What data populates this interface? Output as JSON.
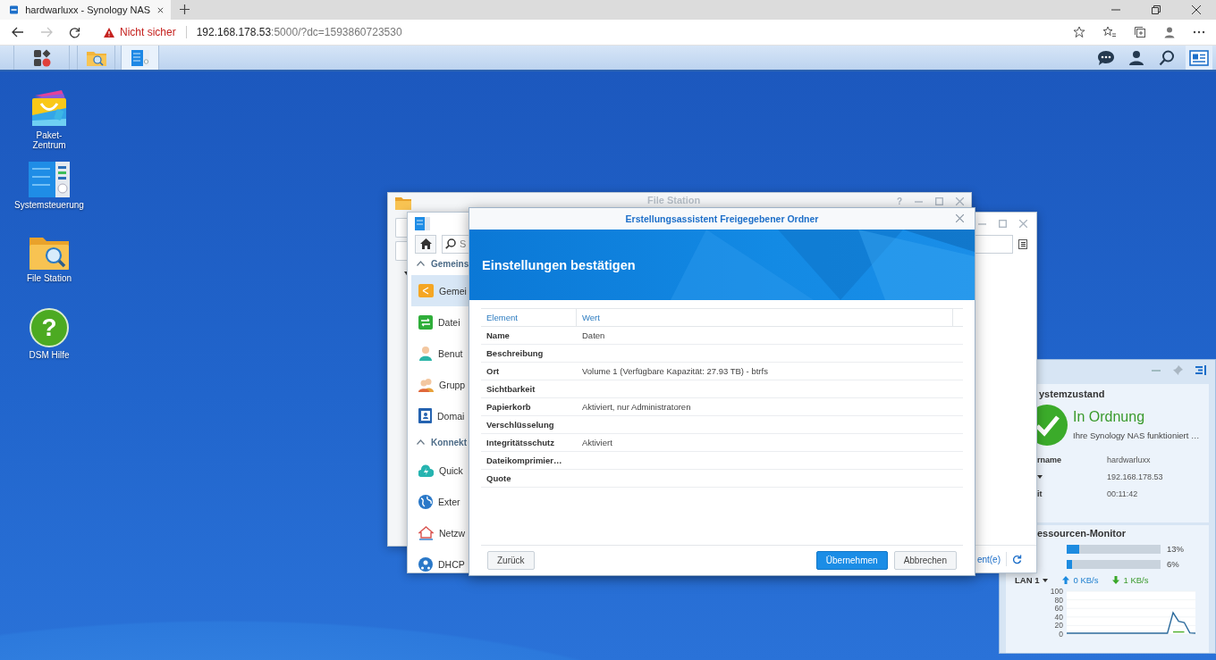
{
  "browser": {
    "tab_title": "hardwarluxx - Synology NAS",
    "security": "Nicht sicher",
    "url_host": "192.168.178.53",
    "url_rest": ":5000/?dc=1593860723530"
  },
  "taskbar": {
    "apps": [
      {
        "kind": "menu",
        "selected": false
      },
      {
        "kind": "file-station",
        "selected": false
      },
      {
        "kind": "control-panel",
        "selected": true
      }
    ],
    "tray": [
      {
        "kind": "chat",
        "selected": false
      },
      {
        "kind": "user",
        "selected": false
      },
      {
        "kind": "search",
        "selected": false
      },
      {
        "kind": "widgets",
        "selected": true
      }
    ]
  },
  "desktop_icons": [
    {
      "kind": "package",
      "label": "Paket-Zentrum"
    },
    {
      "kind": "control-panel",
      "label": "Systemsteuerung"
    },
    {
      "kind": "file-station",
      "label": "File Station"
    },
    {
      "kind": "help",
      "label": "DSM Hilfe",
      "glyph": "?"
    }
  ],
  "file_station": {
    "title": "File Station",
    "help": "?"
  },
  "control_panel": {
    "search_placeholder": "S",
    "footer_text": "ent(e)",
    "sections": [
      {
        "title": "Gemeins",
        "expanded": true,
        "items": [
          {
            "kind": "share",
            "label": "Gemei",
            "selected": true
          },
          {
            "kind": "file-services",
            "label": "Datei",
            "selected": false
          },
          {
            "kind": "user",
            "label": "Benut",
            "selected": false
          },
          {
            "kind": "group",
            "label": "Grupp",
            "selected": false
          },
          {
            "kind": "domain",
            "label": "Domai",
            "selected": false
          }
        ]
      },
      {
        "title": "Konnekt",
        "expanded": true,
        "items": [
          {
            "kind": "quickconnect",
            "label": "Quick",
            "selected": false
          },
          {
            "kind": "external",
            "label": "Exter",
            "selected": false
          },
          {
            "kind": "network",
            "label": "Netzw",
            "selected": false
          },
          {
            "kind": "dhcp",
            "label": "DHCP",
            "selected": false
          }
        ]
      }
    ]
  },
  "dialog": {
    "title": "Erstellungsassistent Freigegebener Ordner",
    "heading": "Einstellungen bestätigen",
    "columns": [
      "Element",
      "Wert"
    ],
    "rows": [
      {
        "element": "Name",
        "value": "Daten"
      },
      {
        "element": "Beschreibung"
      },
      {
        "element": "Ort",
        "value": "Volume 1 (Verfügbare Kapazität: 27.93 TB) - btrfs"
      },
      {
        "element": "Sichtbarkeit"
      },
      {
        "element": "Papierkorb",
        "value": "Aktiviert, nur Administratoren"
      },
      {
        "element": "Verschlüsselung"
      },
      {
        "element": "Integritätsschutz",
        "value": "Aktiviert"
      },
      {
        "element": "Dateikomprimier…"
      },
      {
        "element": "Quote"
      }
    ],
    "buttons": [
      {
        "label": "Zurück",
        "kind": "secondary"
      },
      {
        "label": "Übernehmen",
        "kind": "primary"
      },
      {
        "label": "Abbrechen",
        "kind": "secondary"
      }
    ]
  },
  "widgets": {
    "system": {
      "title": "ystemzustand",
      "status": "In Ordnung",
      "message": "Ihre Synology NAS funktioniert …",
      "rows": [
        {
          "label": "rname",
          "dropdown": false,
          "value": "hardwarluxx"
        },
        {
          "dropdown": true,
          "value": "192.168.178.53"
        },
        {
          "label": "it",
          "dropdown": false,
          "value": "00:11:42"
        }
      ]
    },
    "monitor": {
      "title": "essourcen-Monitor",
      "meters": [
        {
          "level": 0.13,
          "reading": "13%"
        },
        {
          "level": 0.06,
          "reading": "6%"
        }
      ],
      "interface": "LAN 1",
      "upload": "0 KB/s",
      "download": "1 KB/s",
      "chart_data": {
        "type": "line",
        "grid": true,
        "ylim": [
          0,
          100
        ],
        "yticks": [
          0,
          20,
          40,
          60,
          80,
          100
        ],
        "series": [
          {
            "color": "#2b6a9c",
            "values": [
              2,
              2,
              2,
              2,
              2,
              2,
              2,
              2,
              2,
              2,
              2,
              2,
              2,
              2,
              2,
              2,
              2,
              2,
              2,
              50,
              30,
              27,
              3,
              2
            ]
          },
          {
            "color": "#4caf2a",
            "values": [
              null,
              null,
              null,
              null,
              null,
              null,
              null,
              null,
              null,
              null,
              null,
              null,
              null,
              null,
              null,
              null,
              null,
              null,
              null,
              5,
              5,
              5,
              null,
              null
            ]
          }
        ]
      }
    }
  }
}
